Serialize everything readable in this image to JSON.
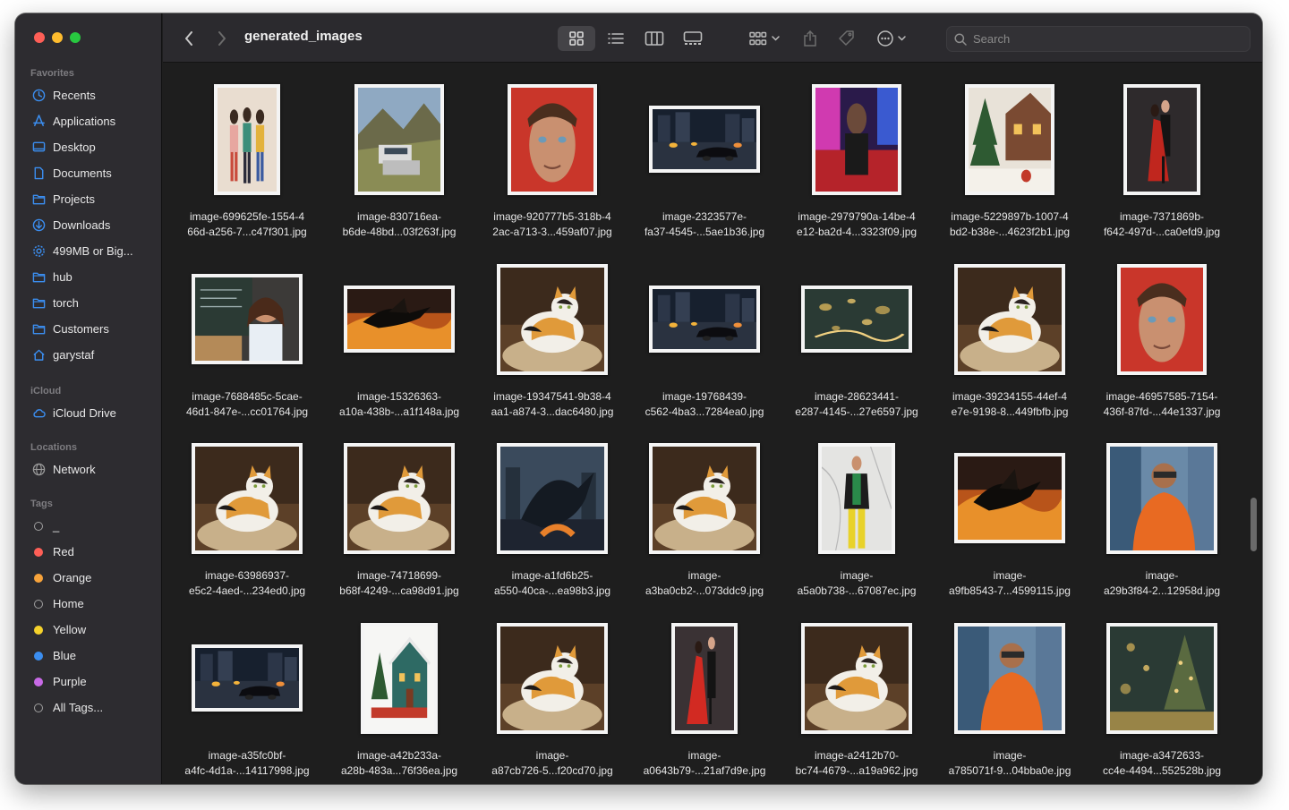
{
  "window": {
    "title": "generated_images"
  },
  "toolbar": {
    "back_icon": "chevron-left-icon",
    "forward_icon": "chevron-right-icon",
    "views": [
      "grid-view-icon",
      "list-view-icon",
      "column-view-icon",
      "gallery-view-icon"
    ],
    "group_icon": "group-icon",
    "share_icon": "share-icon",
    "tag_icon": "tag-icon",
    "more_icon": "more-icon",
    "search_placeholder": "Search"
  },
  "sidebar": {
    "favorites_heading": "Favorites",
    "favorites": [
      {
        "label": "Recents",
        "icon": "clock-icon"
      },
      {
        "label": "Applications",
        "icon": "applications-icon"
      },
      {
        "label": "Desktop",
        "icon": "desktop-icon"
      },
      {
        "label": "Documents",
        "icon": "document-icon"
      },
      {
        "label": "Projects",
        "icon": "folder-icon"
      },
      {
        "label": "Downloads",
        "icon": "download-icon"
      },
      {
        "label": "499MB or Big...",
        "icon": "gear-icon"
      },
      {
        "label": "hub",
        "icon": "folder-icon"
      },
      {
        "label": "torch",
        "icon": "folder-icon"
      },
      {
        "label": "Customers",
        "icon": "folder-icon"
      },
      {
        "label": "garystaf",
        "icon": "home-icon"
      }
    ],
    "icloud_heading": "iCloud",
    "icloud": [
      {
        "label": "iCloud Drive",
        "icon": "cloud-icon"
      }
    ],
    "locations_heading": "Locations",
    "locations": [
      {
        "label": "Network",
        "icon": "network-icon"
      }
    ],
    "tags_heading": "Tags",
    "tags": [
      {
        "label": "_",
        "color": "hollow"
      },
      {
        "label": "Red",
        "color": "#fe5f57"
      },
      {
        "label": "Orange",
        "color": "#f7a33b"
      },
      {
        "label": "Home",
        "color": "hollow"
      },
      {
        "label": "Yellow",
        "color": "#f5d22b"
      },
      {
        "label": "Blue",
        "color": "#3b8ef0"
      },
      {
        "label": "Purple",
        "color": "#c86ae6"
      },
      {
        "label": "All Tags...",
        "color": "alltags"
      }
    ]
  },
  "files": [
    {
      "line1": "image-699625fe-1554-4",
      "line2": "66d-a256-7...c47f301.jpg",
      "shape": "portrait-tall",
      "art": "people"
    },
    {
      "line1": "image-830716ea-",
      "line2": "b6de-48bd...03f263f.jpg",
      "shape": "square",
      "art": "landscape"
    },
    {
      "line1": "image-920777b5-318b-4",
      "line2": "2ac-a713-3...459af07.jpg",
      "shape": "square",
      "art": "face-red"
    },
    {
      "line1": "image-2323577e-",
      "line2": "fa37-4545-...5ae1b36.jpg",
      "shape": "wide",
      "art": "city-night"
    },
    {
      "line1": "image-2979790a-14be-4",
      "line2": "e12-ba2d-4...3323f09.jpg",
      "shape": "square",
      "art": "neon"
    },
    {
      "line1": "image-5229897b-1007-4",
      "line2": "bd2-b38e-...4623f2b1.jpg",
      "shape": "square",
      "art": "xmas-village"
    },
    {
      "line1": "image-7371869b-",
      "line2": "f642-497d-...ca0efd9.jpg",
      "shape": "portrait",
      "art": "dancers"
    },
    {
      "line1": "image-7688485c-5cae-",
      "line2": "46d1-847e-...cc01764.jpg",
      "shape": "landscape",
      "art": "teacher"
    },
    {
      "line1": "image-15326363-",
      "line2": "a10a-438b-...a1f148a.jpg",
      "shape": "wide",
      "art": "dragon-fire"
    },
    {
      "line1": "image-19347541-9b38-4",
      "line2": "aa1-a874-3...dac6480.jpg",
      "shape": "square-lg",
      "art": "cat"
    },
    {
      "line1": "image-19768439-",
      "line2": "c562-4ba3...7284ea0.jpg",
      "shape": "wide",
      "art": "city-night"
    },
    {
      "line1": "image-28623441-",
      "line2": "e287-4145-...27e6597.jpg",
      "shape": "wide",
      "art": "gold-bokeh"
    },
    {
      "line1": "image-39234155-44ef-4",
      "line2": "e7e-9198-8...449fbfb.jpg",
      "shape": "square-lg",
      "art": "cat"
    },
    {
      "line1": "image-46957585-7154-",
      "line2": "436f-87fd-...44e1337.jpg",
      "shape": "square",
      "art": "face-red"
    },
    {
      "line1": "image-63986937-",
      "line2": "e5c2-4aed-...234ed0.jpg",
      "shape": "square-lg",
      "art": "cat"
    },
    {
      "line1": "image-74718699-",
      "line2": "b68f-4249-...ca98d91.jpg",
      "shape": "square-lg",
      "art": "cat"
    },
    {
      "line1": "image-a1fd6b25-",
      "line2": "a550-40ca-...ea98b3.jpg",
      "shape": "square-lg",
      "art": "dragon-castle"
    },
    {
      "line1": "image-",
      "line2": "a3ba0cb2-...073ddc9.jpg",
      "shape": "square-lg",
      "art": "cat"
    },
    {
      "line1": "image-",
      "line2": "a5a0b738-...67087ec.jpg",
      "shape": "portrait",
      "art": "fashion"
    },
    {
      "line1": "image-",
      "line2": "a9fb8543-7...4599115.jpg",
      "shape": "landscape",
      "art": "dragon-fire"
    },
    {
      "line1": "image-",
      "line2": "a29b3f84-2...12958d.jpg",
      "shape": "square-lg",
      "art": "orange-jacket"
    },
    {
      "line1": "image-a35fc0bf-",
      "line2": "a4fc-4d1a-...14117998.jpg",
      "shape": "wide",
      "art": "city-night"
    },
    {
      "line1": "image-a42b233a-",
      "line2": "a28b-483a...76f36ea.jpg",
      "shape": "portrait",
      "art": "xmas-house"
    },
    {
      "line1": "image-",
      "line2": "a87cb726-5...f20cd70.jpg",
      "shape": "square-lg",
      "art": "cat"
    },
    {
      "line1": "image-",
      "line2": "a0643b79-...21af7d9e.jpg",
      "shape": "portrait-tall",
      "art": "dancers-red"
    },
    {
      "line1": "image-a2412b70-",
      "line2": "bc74-4679-...a19a962.jpg",
      "shape": "square-lg",
      "art": "cat"
    },
    {
      "line1": "image-",
      "line2": "a785071f-9...04bba0e.jpg",
      "shape": "square-lg",
      "art": "orange-jacket"
    },
    {
      "line1": "image-a3472633-",
      "line2": "cc4e-4494...552528b.jpg",
      "shape": "square-lg",
      "art": "xmas-tree"
    }
  ]
}
